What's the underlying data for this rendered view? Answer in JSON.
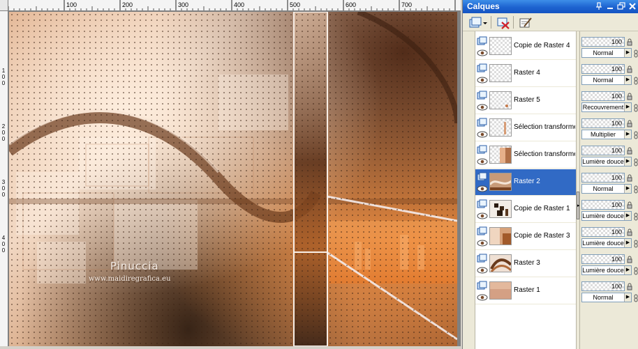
{
  "canvas": {
    "ruler_top_labels": [
      "100",
      "200",
      "300",
      "400",
      "500",
      "600",
      "700"
    ],
    "ruler_left_labels": [
      "1",
      "0",
      "0",
      "2",
      "0",
      "0",
      "3",
      "0",
      "0",
      "4",
      "0",
      "0"
    ],
    "watermark_title": "Pinuccia",
    "watermark_url": "www.maidiregrafica.eu"
  },
  "panel": {
    "title": "Calques",
    "title_buttons": [
      "pin",
      "minimize",
      "restore",
      "close"
    ],
    "toolbar": [
      "new-layer-button",
      "delete-layer-button",
      "layer-properties-button"
    ],
    "layers": [
      {
        "name": "Copie de Raster 4",
        "opacity": "100",
        "blend": "Normal",
        "selected": false,
        "thumb": "transparent"
      },
      {
        "name": "Raster 4",
        "opacity": "100",
        "blend": "Normal",
        "selected": false,
        "thumb": "transparent"
      },
      {
        "name": "Raster 5",
        "opacity": "100",
        "blend": "Recouvrement",
        "selected": false,
        "thumb": "dot"
      },
      {
        "name": "Sélection transformée",
        "opacity": "100",
        "blend": "Multiplier",
        "selected": false,
        "thumb": "stripe"
      },
      {
        "name": "Sélection transformée",
        "opacity": "100",
        "blend": "Lumière douce",
        "selected": false,
        "thumb": "tile"
      },
      {
        "name": "Raster 2",
        "opacity": "100",
        "blend": "Normal",
        "selected": true,
        "thumb": "wave"
      },
      {
        "name": "Copie de Raster 1",
        "opacity": "100",
        "blend": "Lumière douce",
        "selected": false,
        "thumb": "dark"
      },
      {
        "name": "Copie de Raster 3",
        "opacity": "100",
        "blend": "Lumière douce",
        "selected": false,
        "thumb": "amber"
      },
      {
        "name": "Raster 3",
        "opacity": "100",
        "blend": "Lumière douce",
        "selected": false,
        "thumb": "swirl"
      },
      {
        "name": "Raster 1",
        "opacity": "100",
        "blend": "Normal",
        "selected": false,
        "thumb": "beige"
      }
    ]
  },
  "colors": {
    "selection": "#316ac5",
    "titlebar": "#1d63d0",
    "panel_bg": "#ece9d8"
  }
}
